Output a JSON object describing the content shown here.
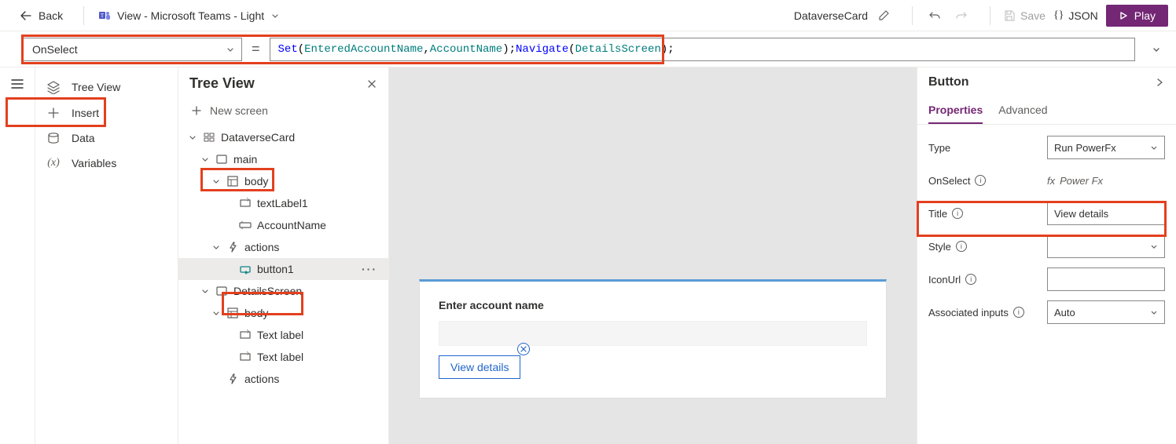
{
  "toolbar": {
    "back_label": "Back",
    "view_label": "View - Microsoft Teams - Light",
    "app_name": "DataverseCard",
    "save_label": "Save",
    "json_label": "JSON",
    "play_label": "Play"
  },
  "formula": {
    "property": "OnSelect",
    "tokens": [
      {
        "t": "fn",
        "v": "Set"
      },
      {
        "t": "punc",
        "v": "("
      },
      {
        "t": "id",
        "v": "EnteredAccountName"
      },
      {
        "t": "punc",
        "v": ", "
      },
      {
        "t": "id",
        "v": "AccountName"
      },
      {
        "t": "punc",
        "v": "); "
      },
      {
        "t": "fn",
        "v": "Navigate"
      },
      {
        "t": "punc",
        "v": "("
      },
      {
        "t": "id",
        "v": "DetailsScreen"
      },
      {
        "t": "punc",
        "v": ");"
      }
    ]
  },
  "left_nav": {
    "items": [
      {
        "icon": "layers",
        "label": "Tree View"
      },
      {
        "icon": "plus",
        "label": "Insert"
      },
      {
        "icon": "data",
        "label": "Data"
      },
      {
        "icon": "var",
        "label": "Variables"
      }
    ]
  },
  "tree": {
    "title": "Tree View",
    "new_screen": "New screen",
    "rows": [
      {
        "indent": 0,
        "chev": "down",
        "icon": "app",
        "label": "DataverseCard"
      },
      {
        "indent": 1,
        "chev": "down",
        "icon": "screen",
        "label": "main"
      },
      {
        "indent": 2,
        "chev": "down",
        "icon": "body",
        "label": "body"
      },
      {
        "indent": 3,
        "chev": "none",
        "icon": "text",
        "label": "textLabel1"
      },
      {
        "indent": 3,
        "chev": "none",
        "icon": "input",
        "label": "AccountName"
      },
      {
        "indent": 2,
        "chev": "down",
        "icon": "actions",
        "label": "actions"
      },
      {
        "indent": 3,
        "chev": "none",
        "icon": "button",
        "label": "button1",
        "selected": true,
        "more": true
      },
      {
        "indent": 1,
        "chev": "down",
        "icon": "screen",
        "label": "DetailsScreen"
      },
      {
        "indent": 2,
        "chev": "down",
        "icon": "body",
        "label": "body"
      },
      {
        "indent": 3,
        "chev": "none",
        "icon": "text",
        "label": "Text label"
      },
      {
        "indent": 3,
        "chev": "none",
        "icon": "text",
        "label": "Text label"
      },
      {
        "indent": 2,
        "chev": "none",
        "icon": "actions",
        "label": "actions"
      }
    ]
  },
  "canvas": {
    "card_label": "Enter account name",
    "card_button": "View details"
  },
  "props": {
    "title": "Button",
    "tabs": {
      "properties": "Properties",
      "advanced": "Advanced"
    },
    "rows": {
      "type_label": "Type",
      "type_value": "Run PowerFx",
      "onselect_label": "OnSelect",
      "onselect_value": "Power Fx",
      "title_label": "Title",
      "title_value": "View details",
      "style_label": "Style",
      "iconurl_label": "IconUrl",
      "assoc_label": "Associated inputs",
      "assoc_value": "Auto"
    }
  }
}
